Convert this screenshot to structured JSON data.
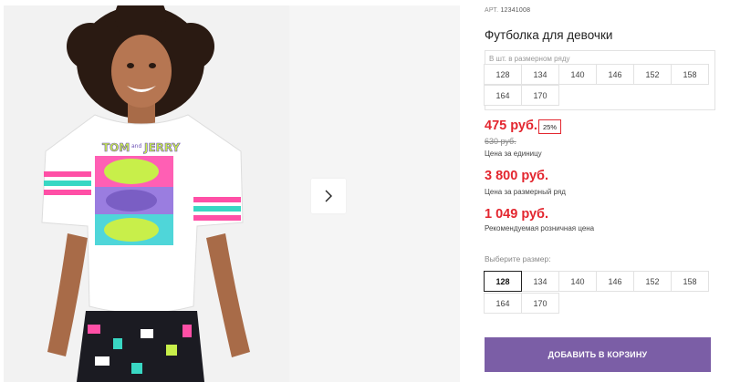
{
  "product": {
    "article_label": "АРТ.",
    "article_number": "12341008",
    "title": "Футболка для девочки"
  },
  "size_row": {
    "caption": "В шт. в размерном ряду",
    "sizes": [
      "128",
      "134",
      "140",
      "146",
      "152",
      "158",
      "164",
      "170"
    ]
  },
  "pricing": {
    "unit_price": "475 руб.",
    "discount": "25%",
    "old_price": "630 руб.",
    "unit_price_note": "Цена за единицу",
    "row_price": "3 800 руб.",
    "row_price_note": "Цена за размерный ряд",
    "retail_price": "1 049 руб.",
    "retail_price_note": "Рекомендуемая розничная цена"
  },
  "size_selector": {
    "label": "Выберите размер:",
    "selected": "128",
    "options": [
      "128",
      "134",
      "140",
      "146",
      "152",
      "158",
      "164",
      "170"
    ]
  },
  "cart": {
    "button_label": "ДОБАВИТЬ В КОРЗИНУ"
  },
  "photo": {
    "print_text_1": "TOM",
    "print_text_2": "and",
    "print_text_3": "JERRY"
  },
  "colors": {
    "accent": "#7b5ea6",
    "price": "#e3262f"
  }
}
